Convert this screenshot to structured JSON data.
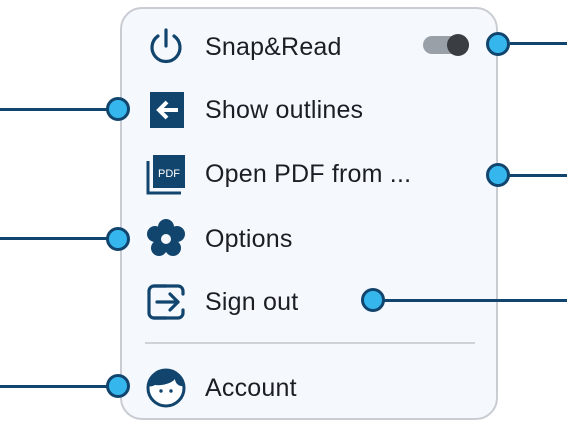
{
  "menu": {
    "items": [
      {
        "label": "Snap&Read",
        "icon": "power-icon"
      },
      {
        "label": "Show outlines",
        "icon": "outline-arrow-icon"
      },
      {
        "label": "Open PDF from ...",
        "icon": "pdf-icon",
        "icon_text": "PDF"
      },
      {
        "label": "Options",
        "icon": "gear-flower-icon"
      },
      {
        "label": "Sign out",
        "icon": "sign-out-icon"
      },
      {
        "label": "Account",
        "icon": "account-face-icon"
      }
    ],
    "toggle": {
      "state": "off"
    }
  },
  "colors": {
    "brand_blue": "#12456e",
    "callout_fill": "#35b7ee",
    "menu_bg": "#f5f8fd",
    "menu_border": "#c9ccd2"
  }
}
